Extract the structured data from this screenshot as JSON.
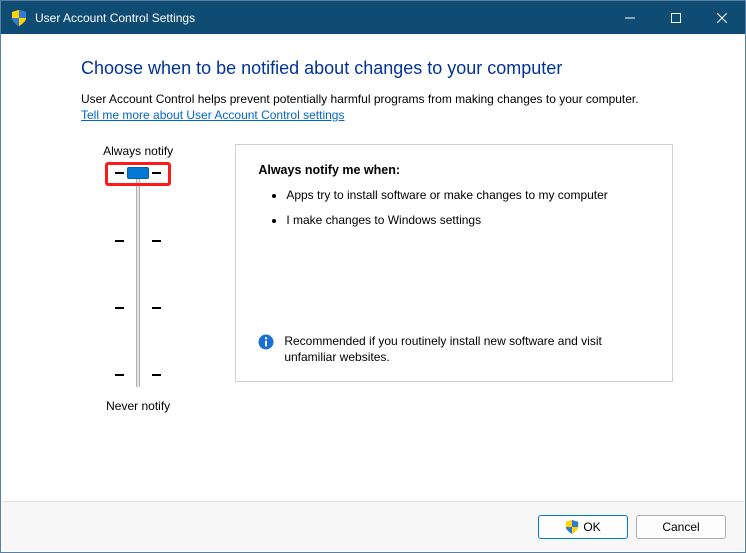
{
  "window": {
    "title": "User Account Control Settings"
  },
  "main": {
    "heading": "Choose when to be notified about changes to your computer",
    "description": "User Account Control helps prevent potentially harmful programs from making changes to your computer.",
    "link": "Tell me more about User Account Control settings"
  },
  "slider": {
    "top_label": "Always notify",
    "bottom_label": "Never notify",
    "levels": 4,
    "current_level_index": 0
  },
  "panel": {
    "title": "Always notify me when:",
    "bullets": [
      "Apps try to install software or make changes to my computer",
      "I make changes to Windows settings"
    ],
    "recommendation": "Recommended if you routinely install new software and visit unfamiliar websites."
  },
  "footer": {
    "ok_label": "OK",
    "cancel_label": "Cancel"
  },
  "icons": {
    "shield": "shield-icon",
    "info": "info-icon",
    "minimize": "minimize-icon",
    "maximize": "maximize-icon",
    "close": "close-icon"
  }
}
